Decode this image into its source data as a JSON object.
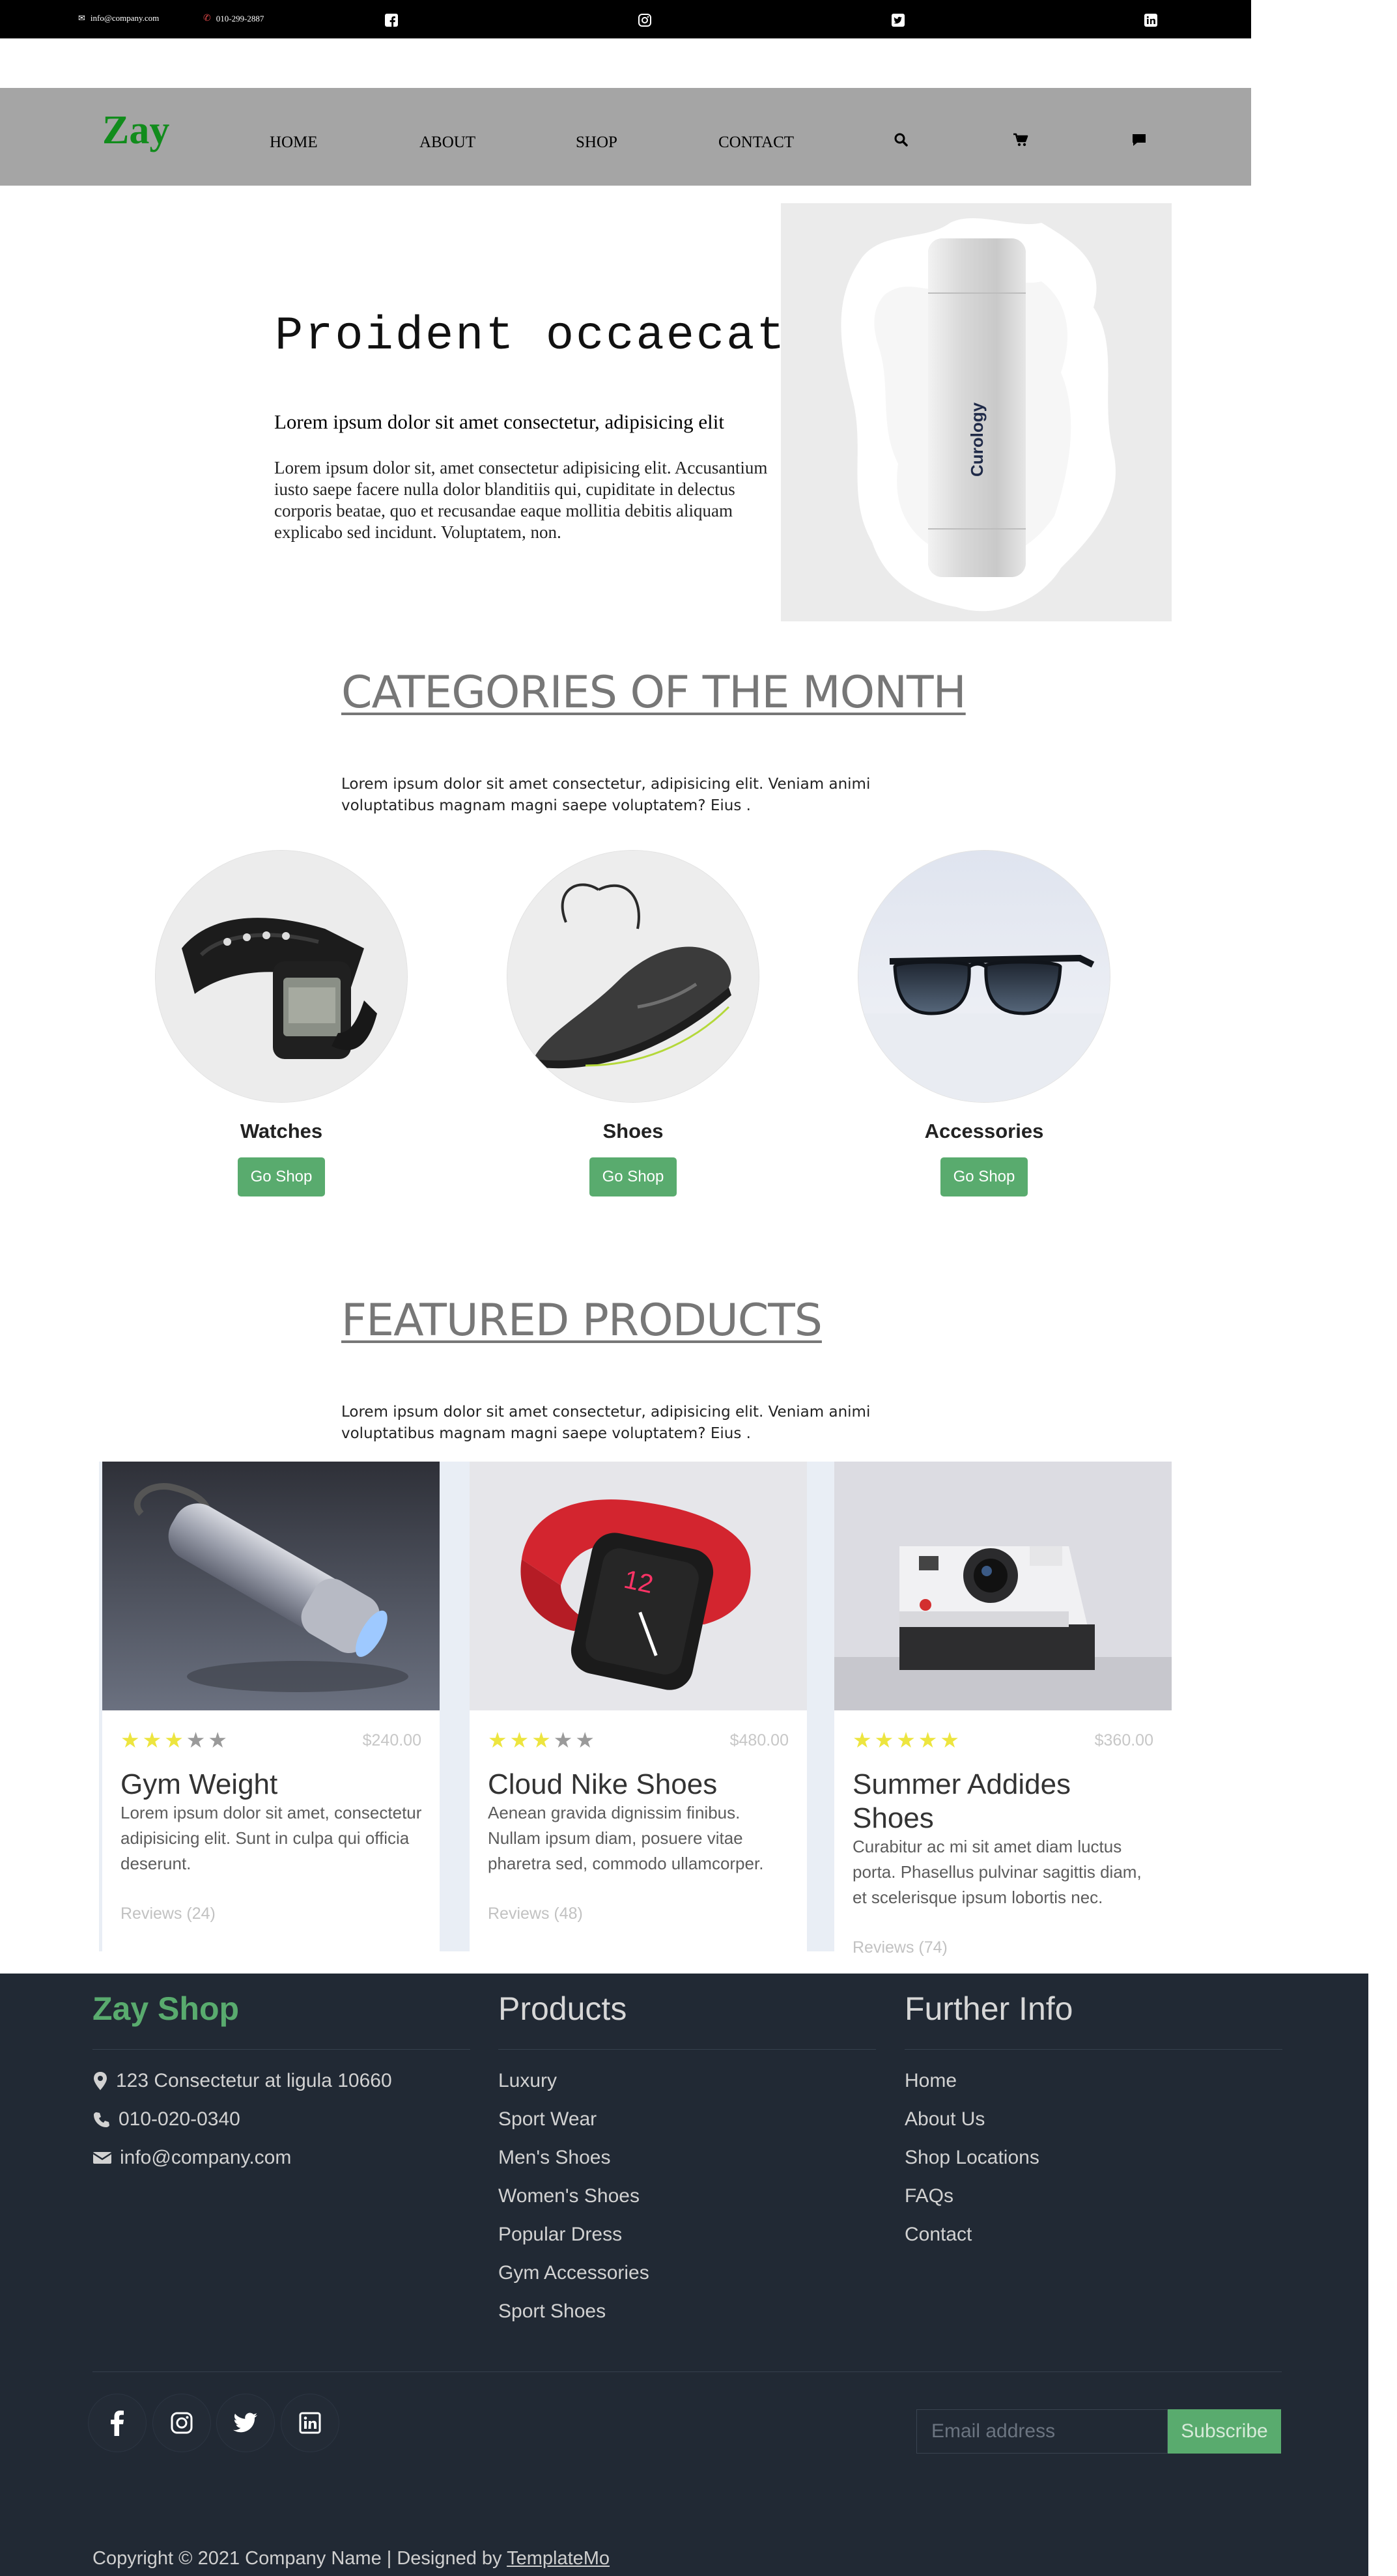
{
  "topbar": {
    "email": "info@company.com",
    "phone": "010-299-2887",
    "icons": [
      "facebook-icon",
      "instagram-icon",
      "twitter-icon",
      "linkedin-icon"
    ]
  },
  "nav": {
    "logo": "Zay",
    "links": [
      "HOME",
      "ABOUT",
      "SHOP",
      "CONTACT"
    ],
    "icons": [
      "search-icon",
      "cart-icon",
      "chat-icon"
    ]
  },
  "hero": {
    "title": "Proident occaecat",
    "subtitle": "Lorem ipsum dolor sit amet consectetur, adipisicing elit",
    "text": "Lorem ipsum dolor sit, amet consectetur adipisicing elit. Accusantium iusto saepe facere nulla dolor blanditiis qui, cupiditate in delectus corporis beatae, quo et recusandae eaque mollitia debitis aliquam explicabo sed incidunt. Voluptatem, non.",
    "product_label": "Curology"
  },
  "categories": {
    "title": "CATEGORIES OF THE MONTH",
    "text": "Lorem ipsum dolor sit amet consectetur, adipisicing elit. Veniam animi voluptatibus magnam magni saepe voluptatem? Eius .",
    "items": [
      {
        "name": "Watches",
        "button": "Go Shop"
      },
      {
        "name": "Shoes",
        "button": "Go Shop"
      },
      {
        "name": "Accessories",
        "button": "Go Shop"
      }
    ]
  },
  "featured": {
    "title": "FEATURED PRODUCTS",
    "text": "Lorem ipsum dolor sit amet consectetur, adipisicing elit. Veniam animi voluptatibus magnam magni saepe voluptatem? Eius .",
    "products": [
      {
        "name": "Gym Weight",
        "price": "$240.00",
        "rating": 3,
        "description": "Lorem ipsum dolor sit amet, consectetur adipisicing elit. Sunt in culpa qui officia deserunt.",
        "reviews": "Reviews (24)"
      },
      {
        "name": "Cloud Nike Shoes",
        "price": "$480.00",
        "rating": 3,
        "description": "Aenean gravida dignissim finibus. Nullam ipsum diam, posuere vitae pharetra sed, commodo ullamcorper.",
        "reviews": "Reviews (48)"
      },
      {
        "name": "Summer Addides Shoes",
        "price": "$360.00",
        "rating": 5,
        "description": "Curabitur ac mi sit amet diam luctus porta. Phasellus pulvinar sagittis diam, et scelerisque ipsum lobortis nec.",
        "reviews": "Reviews (74)"
      }
    ]
  },
  "footer": {
    "brand": "Zay Shop",
    "address": "123 Consectetur at ligula 10660",
    "phone": "010-020-0340",
    "email": "info@company.com",
    "products_title": "Products",
    "products": [
      "Luxury",
      "Sport Wear",
      "Men's Shoes",
      "Women's Shoes",
      "Popular Dress",
      "Gym Accessories",
      "Sport Shoes"
    ],
    "info_title": "Further Info",
    "info": [
      "Home",
      "About Us",
      "Shop Locations",
      "FAQs",
      "Contact"
    ],
    "email_placeholder": "Email address",
    "subscribe": "Subscribe",
    "copyright": "Copyright © 2021 Company Name | Designed by ",
    "designer": "TemplateMo"
  },
  "colors": {
    "brand_green": "#118c1c",
    "accent_green": "#59ab6e",
    "footer_bg": "#212934",
    "nav_bg": "#a5a5a5"
  }
}
